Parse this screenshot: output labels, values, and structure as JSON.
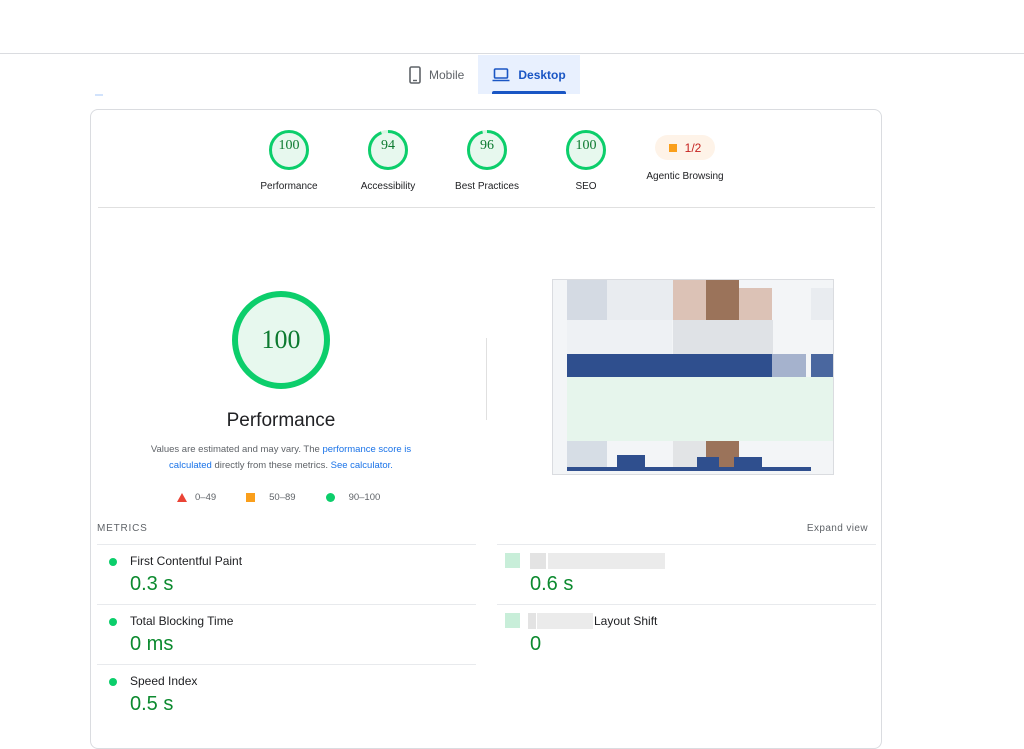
{
  "tabs": [
    {
      "label": "Mobile",
      "icon": "phone-icon",
      "active": false
    },
    {
      "label": "Desktop",
      "icon": "laptop-icon",
      "active": true
    }
  ],
  "categories": [
    {
      "label": "Performance",
      "score": "100",
      "value": 100
    },
    {
      "label": "Accessibility",
      "score": "94",
      "value": 94
    },
    {
      "label": "Best Practices",
      "score": "96",
      "value": 96
    },
    {
      "label": "SEO",
      "score": "100",
      "value": 100
    },
    {
      "label": "Agentic Browsing",
      "score": "1/2",
      "value": 50
    }
  ],
  "performance": {
    "score": "100",
    "title": "Performance",
    "desc_1": "Values are estimated and may vary. The ",
    "link_1": "performance score is calculated",
    "desc_2": " directly from these metrics. ",
    "link_2": "See calculator."
  },
  "legend": {
    "fail": "0–49",
    "average": "50–89",
    "pass": "90–100"
  },
  "metrics_header": "METRICS",
  "expand_label": "Expand view",
  "metrics": [
    {
      "name": "First Contentful Paint",
      "value": "0.3 s"
    },
    {
      "name": "",
      "value": "0.6 s"
    },
    {
      "name": "Total Blocking Time",
      "value": "0 ms"
    },
    {
      "name": "Layout Shift",
      "value": "0"
    },
    {
      "name": "Speed Index",
      "value": "0.5 s"
    }
  ],
  "colors": {
    "pass": "#0cce6b",
    "average": "#fa9f1b",
    "fail": "#ea4335",
    "accent": "#1a56c4"
  }
}
